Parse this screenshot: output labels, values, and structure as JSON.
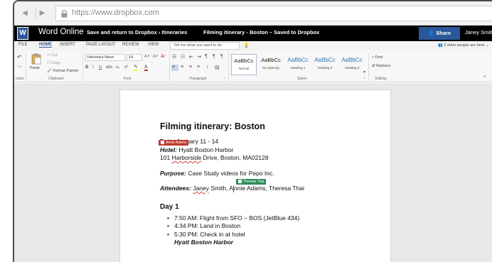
{
  "browser": {
    "url": "https://www.dropbox.com"
  },
  "titlebar": {
    "logo_letter": "W",
    "app_name": "Word Online",
    "breadcrumb": "Save and return to Dropbox  ›  Itineraries",
    "doc_title": "Filming itinerary - Boston   –   Saved to Dropbox",
    "share_label": "Share",
    "user_name": "Janey Smith"
  },
  "tabs": [
    "FILE",
    "HOME",
    "INSERT",
    "PAGE LAYOUT",
    "REVIEW",
    "VIEW"
  ],
  "active_tab": "HOME",
  "tellme_placeholder": "Tell me what you want to do",
  "others_editing": "2 other people are here ⌄",
  "ribbon": {
    "undo_label": "Undo",
    "clipboard": {
      "paste": "Paste",
      "cut": "Cut",
      "copy": "Copy",
      "format_painter": "Format Painter",
      "label": "Clipboard"
    },
    "font": {
      "name": "Helvetica Neue",
      "size": "14",
      "label": "Font"
    },
    "paragraph_label": "Paragraph",
    "styles": {
      "label": "Styles",
      "items": [
        {
          "sample": "AaBbCc",
          "name": "Normal"
        },
        {
          "sample": "AaBbCc",
          "name": "No Spacing"
        },
        {
          "sample": "AaBbCc",
          "name": "Heading 1"
        },
        {
          "sample": "AaBbCc",
          "name": "Heading 2"
        },
        {
          "sample": "AaBbCc",
          "name": "Heading 3"
        }
      ]
    },
    "editing": {
      "find": "Find",
      "replace": "Replace",
      "label": "Editing"
    }
  },
  "document": {
    "title": "Filming itinerary: Boston",
    "date_label": "Date:",
    "date_value": " January 11 - 14",
    "hotel_label": "Hotel:",
    "hotel_value": " Hyatt Boston Harbor",
    "address_pre": "101 ",
    "address_word": "Harborside",
    "address_post": " Drive, Boston, MA02128",
    "purpose_label": "Purpose:",
    "purpose_value": " Case Study videos for Pepo Inc.",
    "attendees_label": "Attendees:",
    "attendee_1": "Janey",
    "attendees_mid": " Smith, A",
    "attendees_rest": "nnie Adams, Theresa Thai",
    "day_heading": "Day 1",
    "bullets": [
      "7:50 AM: Flight from SFO – BOS (JetBlue 434)",
      "4:34 PM: Land in Boston",
      "5:30 PM: Check in at hotel"
    ],
    "sub_line": "Hyatt Boston Harbor"
  },
  "collaborators": [
    {
      "name": "Annie Adams",
      "color": "#c0392b"
    },
    {
      "name": "Theresa Thai",
      "color": "#2e8b57"
    }
  ],
  "colors": {
    "word_blue": "#2b579a",
    "titlebar": "#000000",
    "canvas": "#e8e8e8"
  }
}
